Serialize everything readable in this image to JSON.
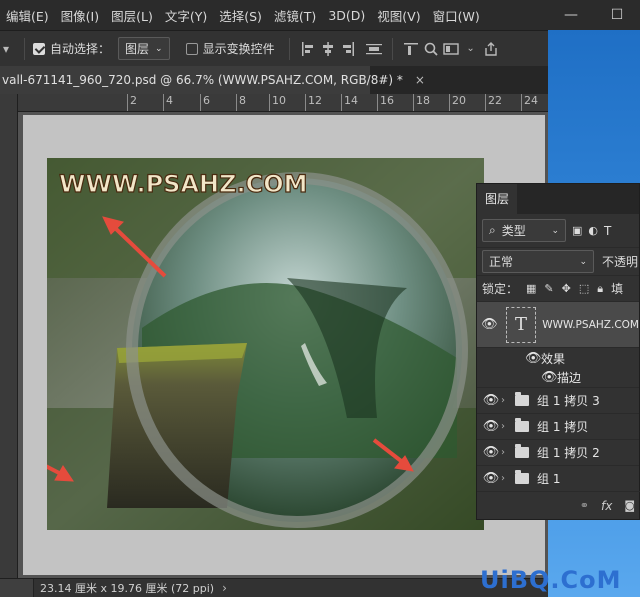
{
  "menu": {
    "items": [
      "编辑(E)",
      "图像(I)",
      "图层(L)",
      "文字(Y)",
      "选择(S)",
      "滤镜(T)",
      "3D(D)",
      "视图(V)",
      "窗口(W)"
    ],
    "minimize": "—",
    "maximize": "☐"
  },
  "options": {
    "auto_select_label": "自动选择：",
    "auto_select_target": "图层",
    "show_transform_label": "显示变换控件"
  },
  "document": {
    "tab_title": "vall-671141_960_720.psd @ 66.7% (WWW.PSAHZ.COM, RGB/8#) *",
    "close_glyph": "×",
    "watermark_text": "WWW.PSAHZ.COM"
  },
  "ruler": {
    "ticks": [
      "2",
      "4",
      "6",
      "8",
      "10",
      "12",
      "14",
      "16",
      "18",
      "20",
      "22",
      "24"
    ]
  },
  "status": {
    "doc_size": "23.14 厘米 x 19.76 厘米 (72 ppi)",
    "arrow": "›"
  },
  "layers_panel": {
    "tab_label": "图层",
    "filter_kind": "类型",
    "blend_mode": "正常",
    "opacity_label": "不透明",
    "lock_label": "锁定：",
    "fill_label": "填",
    "text_layer_name": "WWW.PSAHZ.COM",
    "effects_label": "效果",
    "stroke_label": "描边",
    "groups": [
      "组 1 拷贝 3",
      "组 1 拷贝",
      "组 1 拷贝 2",
      "组 1"
    ],
    "fx_label": "fx"
  },
  "site_watermark": "UiBQ.CoM"
}
